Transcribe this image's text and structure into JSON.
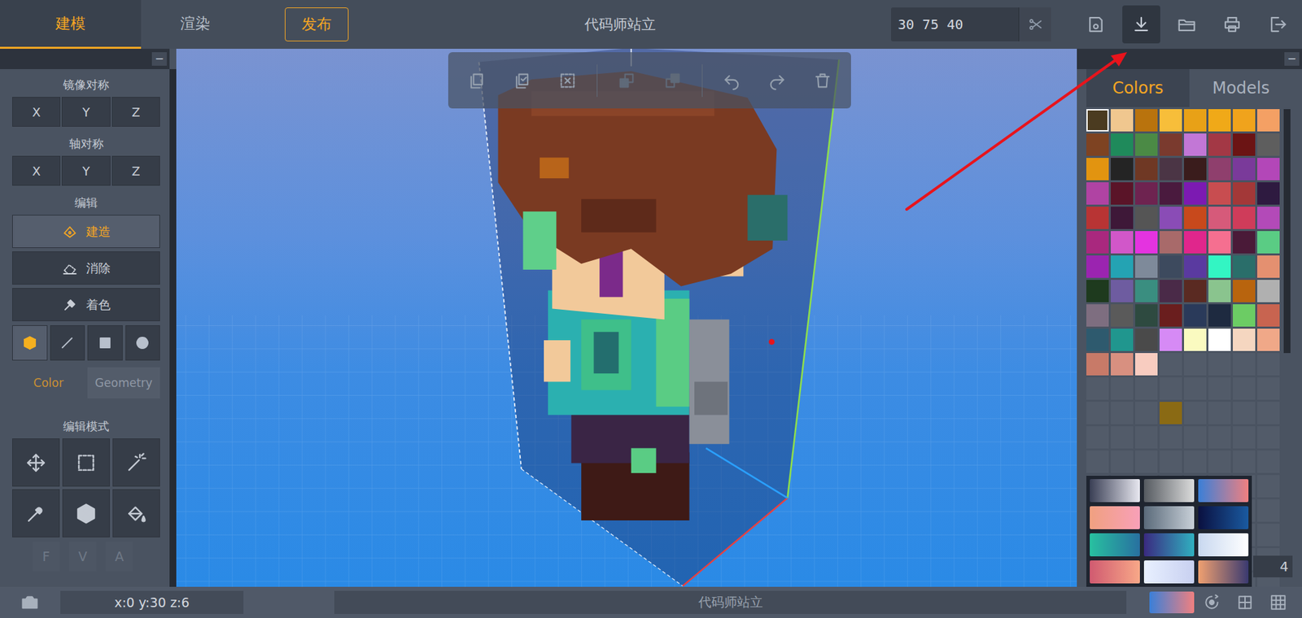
{
  "window": {
    "title": "代码师站立"
  },
  "top_tabs": [
    {
      "label": "建模",
      "selected": true
    },
    {
      "label": "渲染",
      "selected": false
    }
  ],
  "publish_button": "发布",
  "dimensions": "30 75 40",
  "top_actions": [
    {
      "kind": "save",
      "selected": false
    },
    {
      "kind": "download",
      "selected": true
    },
    {
      "kind": "folder",
      "selected": false
    },
    {
      "kind": "print",
      "selected": false
    },
    {
      "kind": "exit",
      "selected": false
    }
  ],
  "panel_collapse": "−",
  "mirror": {
    "title": "镜像对称",
    "axes": [
      {
        "label": "X",
        "selected": false
      },
      {
        "label": "Y",
        "selected": false
      },
      {
        "label": "Z",
        "selected": false
      }
    ]
  },
  "axis_symmetry": {
    "title": "轴对称",
    "axes": [
      {
        "label": "X",
        "selected": false
      },
      {
        "label": "Y",
        "selected": false
      },
      {
        "label": "Z",
        "selected": false
      }
    ]
  },
  "edit": {
    "title": "编辑",
    "actions": [
      {
        "label": "建造",
        "kind": "build",
        "selected": true
      },
      {
        "label": "消除",
        "kind": "erase",
        "selected": false
      },
      {
        "label": "着色",
        "kind": "paint",
        "selected": false
      }
    ],
    "shapes": [
      {
        "kind": "cube",
        "selected": true
      },
      {
        "kind": "line",
        "selected": false
      },
      {
        "kind": "square",
        "selected": false
      },
      {
        "kind": "circle",
        "selected": false
      }
    ],
    "modes": [
      {
        "label": "Color",
        "selected": true
      },
      {
        "label": "Geometry",
        "selected": false
      }
    ]
  },
  "edit_mode": {
    "title": "编辑模式",
    "tools": [
      {
        "kind": "move",
        "selected": false
      },
      {
        "kind": "select-rect",
        "selected": false
      },
      {
        "kind": "magic-wand",
        "selected": false
      },
      {
        "kind": "eyedropper",
        "selected": false
      },
      {
        "kind": "hex-x",
        "selected": false
      },
      {
        "kind": "paint-bucket",
        "selected": false
      }
    ],
    "flags": [
      {
        "label": "F",
        "disabled": true
      },
      {
        "label": "V",
        "disabled": true
      },
      {
        "label": "A",
        "disabled": true
      }
    ]
  },
  "edit_toolbar": [
    {
      "kind": "copy",
      "disabled": false
    },
    {
      "kind": "copy-check",
      "disabled": false
    },
    {
      "kind": "deselect",
      "disabled": false
    },
    {
      "kind": "layer-front",
      "disabled": true
    },
    {
      "kind": "layer-back",
      "disabled": true
    },
    {
      "kind": "undo",
      "disabled": false
    },
    {
      "kind": "redo",
      "disabled": false
    },
    {
      "kind": "trash",
      "disabled": false
    }
  ],
  "panel_tabs": [
    {
      "label": "Colors",
      "selected": true
    },
    {
      "label": "Models",
      "selected": false
    }
  ],
  "palette": [
    {
      "color": "#4b3b20",
      "selected": true
    },
    {
      "color": "#f0c78f",
      "selected": false
    },
    {
      "color": "#b9730d",
      "selected": false
    },
    {
      "color": "#f7be3a",
      "selected": false
    },
    {
      "color": "#e8a117",
      "selected": false
    },
    {
      "color": "#f0a918",
      "selected": false
    },
    {
      "color": "#f0a31c",
      "selected": false
    },
    {
      "color": "#f4a064",
      "selected": false
    },
    {
      "color": "#7e4322",
      "selected": false
    },
    {
      "color": "#1f8a5b",
      "selected": false
    },
    {
      "color": "#4b8a45",
      "selected": false
    },
    {
      "color": "#7a3a2e",
      "selected": false
    },
    {
      "color": "#c277d6",
      "selected": false
    },
    {
      "color": "#a33845",
      "selected": false
    },
    {
      "color": "#6b1414",
      "selected": false
    },
    {
      "color": "#5e5e5e",
      "selected": false
    },
    {
      "color": "#e29410",
      "selected": false
    },
    {
      "color": "#242424",
      "selected": false
    },
    {
      "color": "#6f3824",
      "selected": false
    },
    {
      "color": "#4b3545",
      "selected": false
    },
    {
      "color": "#3a1c1c",
      "selected": false
    },
    {
      "color": "#8f3f6d",
      "selected": false
    },
    {
      "color": "#7a3a9a",
      "selected": false
    },
    {
      "color": "#b347b8",
      "selected": false
    },
    {
      "color": "#b043a3",
      "selected": false
    },
    {
      "color": "#5a1428",
      "selected": false
    },
    {
      "color": "#6e2350",
      "selected": false
    },
    {
      "color": "#4a1a3e",
      "selected": false
    },
    {
      "color": "#7c1ab2",
      "selected": false
    },
    {
      "color": "#c84d50",
      "selected": false
    },
    {
      "color": "#a33838",
      "selected": false
    },
    {
      "color": "#2e1a40",
      "selected": false
    },
    {
      "color": "#b83434",
      "selected": false
    },
    {
      "color": "#3e1838",
      "selected": false
    },
    {
      "color": "#555555",
      "selected": false
    },
    {
      "color": "#8a4cb6",
      "selected": false
    },
    {
      "color": "#c8491c",
      "selected": false
    },
    {
      "color": "#d65a7a",
      "selected": false
    },
    {
      "color": "#cf3c5a",
      "selected": false
    },
    {
      "color": "#b34ab8",
      "selected": false
    },
    {
      "color": "#a9287e",
      "selected": false
    },
    {
      "color": "#d157c9",
      "selected": false
    },
    {
      "color": "#e433e0",
      "selected": false
    },
    {
      "color": "#a86a6a",
      "selected": false
    },
    {
      "color": "#e0268c",
      "selected": false
    },
    {
      "color": "#f56f90",
      "selected": false
    },
    {
      "color": "#4a1a38",
      "selected": false
    },
    {
      "color": "#5acc84",
      "selected": false
    },
    {
      "color": "#9b24b0",
      "selected": false
    },
    {
      "color": "#24a3b3",
      "selected": false
    },
    {
      "color": "#7e8a9a",
      "selected": false
    },
    {
      "color": "#3d4a5e",
      "selected": false
    },
    {
      "color": "#5a3aa0",
      "selected": false
    },
    {
      "color": "#33f5c3",
      "selected": false
    },
    {
      "color": "#2a6e6a",
      "selected": false
    },
    {
      "color": "#e49070",
      "selected": false
    },
    {
      "color": "#1e3a1e",
      "selected": false
    },
    {
      "color": "#6e5ca0",
      "selected": false
    },
    {
      "color": "#3a8e80",
      "selected": false
    },
    {
      "color": "#4a2a48",
      "selected": false
    },
    {
      "color": "#5a2a22",
      "selected": false
    },
    {
      "color": "#8ac48e",
      "selected": false
    },
    {
      "color": "#b8640e",
      "selected": false
    },
    {
      "color": "#b0b0b0",
      "selected": false
    },
    {
      "color": "#7e6e80",
      "selected": false
    },
    {
      "color": "#5a5a5a",
      "selected": false
    },
    {
      "color": "#2e4a40",
      "selected": false
    },
    {
      "color": "#6a1e1e",
      "selected": false
    },
    {
      "color": "#2a3a5a",
      "selected": false
    },
    {
      "color": "#1e2a40",
      "selected": false
    },
    {
      "color": "#6ccc64",
      "selected": false
    },
    {
      "color": "#c86450",
      "selected": false
    },
    {
      "color": "#2e5a6e",
      "selected": false
    },
    {
      "color": "#20968e",
      "selected": false
    },
    {
      "color": "#4a4a4a",
      "selected": false
    },
    {
      "color": "#d68af5",
      "selected": false
    },
    {
      "color": "#fafac0",
      "selected": false
    },
    {
      "color": "#ffffff",
      "selected": false
    },
    {
      "color": "#f5d6c0",
      "selected": false
    },
    {
      "color": "#f0a888",
      "selected": false
    },
    {
      "color": "#c87a68",
      "selected": false
    },
    {
      "color": "#d89080",
      "selected": false
    },
    {
      "color": "#f8ccc0",
      "selected": false
    },
    {
      "color": null,
      "selected": false
    },
    {
      "color": null,
      "selected": false
    },
    {
      "color": null,
      "selected": false
    },
    {
      "color": null,
      "selected": false
    },
    {
      "color": null,
      "selected": false
    },
    {
      "color": null,
      "selected": false
    },
    {
      "color": null,
      "selected": false
    },
    {
      "color": null,
      "selected": false
    },
    {
      "color": null,
      "selected": false
    },
    {
      "color": null,
      "selected": false
    },
    {
      "color": null,
      "selected": false
    },
    {
      "color": null,
      "selected": false
    },
    {
      "color": null,
      "selected": false
    },
    {
      "color": null,
      "selected": false
    },
    {
      "color": null,
      "selected": false
    },
    {
      "color": null,
      "selected": false
    },
    {
      "color": "#8a6a14",
      "selected": false
    }
  ],
  "gradients": [
    {
      "colors": [
        "#3a3f55",
        "#e8e8f0"
      ]
    },
    {
      "colors": [
        "#555a60",
        "#dcdcdc"
      ]
    },
    {
      "colors": [
        "#3a7fd8",
        "#f08080"
      ]
    },
    {
      "colors": [
        "#f0a080",
        "#f8a0b8"
      ]
    },
    {
      "colors": [
        "#5a6a7a",
        "#c8d0d8"
      ]
    },
    {
      "colors": [
        "#0a1040",
        "#1a5aa0"
      ]
    },
    {
      "colors": [
        "#28c0a0",
        "#2870a0"
      ]
    },
    {
      "colors": [
        "#3a2a80",
        "#30b0c0"
      ]
    },
    {
      "colors": [
        "#c8d8f0",
        "#ffffff"
      ]
    },
    {
      "colors": [
        "#d05a70",
        "#f8a888"
      ]
    },
    {
      "colors": [
        "#e8f0ff",
        "#c8d0f0"
      ]
    },
    {
      "colors": [
        "#f0a070",
        "#3a3a70"
      ]
    }
  ],
  "palette_page": "4",
  "status_bar": {
    "coords": "x:0 y:30 z:6",
    "model_name": "代码师站立",
    "current_gradient": [
      "#3a7fd8",
      "#f08080"
    ],
    "icons": [
      {
        "kind": "orbit"
      },
      {
        "kind": "grid"
      },
      {
        "kind": "grid-dense"
      }
    ]
  }
}
